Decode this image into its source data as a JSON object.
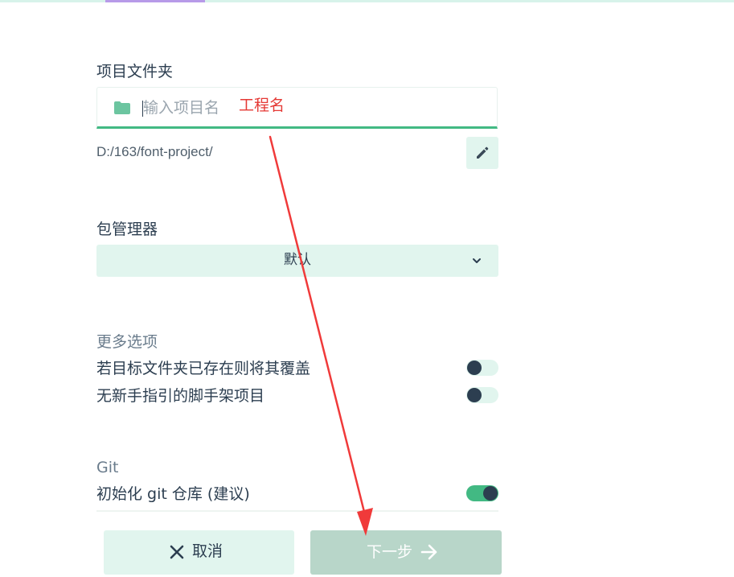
{
  "project_folder": {
    "label": "项目文件夹",
    "placeholder": "输入项目名",
    "value": "",
    "icon": "folder-icon",
    "path": "D:/163/font-project/",
    "edit_icon": "pencil-icon"
  },
  "annotation": {
    "text": "工程名",
    "color": "#e53935"
  },
  "package_manager": {
    "label": "包管理器",
    "selected": "默认"
  },
  "more_options": {
    "title": "更多选项",
    "items": [
      {
        "label": "若目标文件夹已存在则将其覆盖",
        "enabled": false
      },
      {
        "label": "无新手指引的脚手架项目",
        "enabled": false
      }
    ]
  },
  "git": {
    "title": "Git",
    "init_label": "初始化 git 仓库 (建议)",
    "init_enabled": true
  },
  "buttons": {
    "cancel_label": "取消",
    "next_label": "下一步"
  },
  "colors": {
    "accent": "#42b983",
    "light_accent": "#e1f5ee",
    "text": "#2c3e50",
    "annotation": "#e53935",
    "disabled_next": "#b8d6c9"
  }
}
